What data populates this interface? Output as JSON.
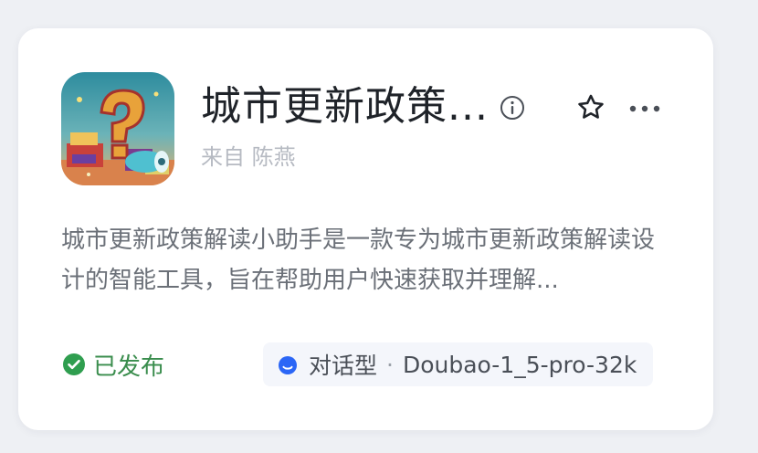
{
  "card": {
    "title": "城市更新政策...",
    "author": "来自 陈燕",
    "description": "城市更新政策解读小助手是一款专为城市更新政策解读设计的智能工具，旨在帮助用户快速获取并理解...",
    "status": "已发布",
    "mode": "对话型",
    "separator": "·",
    "model": "Doubao-1_5-pro-32k"
  },
  "icons": {
    "info": "info-circle-icon",
    "favorite": "star-outline-icon",
    "more": "more-horizontal-icon",
    "status": "check-circle-icon",
    "mode": "chat-bubble-icon"
  },
  "colors": {
    "status_green": "#2f9e4f",
    "chat_blue": "#2b66f6",
    "title": "#1f2329",
    "muted": "#b6bac2"
  }
}
